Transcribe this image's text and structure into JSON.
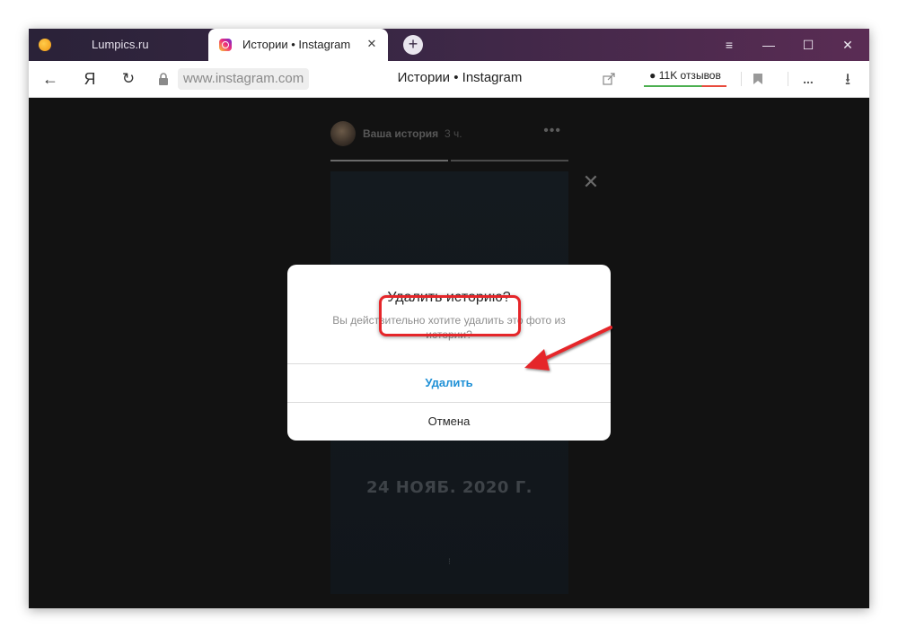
{
  "browser": {
    "tabs": [
      {
        "label": "Lumpics.ru",
        "active": false
      },
      {
        "label": "Истории • Instagram",
        "active": true
      }
    ],
    "new_tab_icon": "plus-icon",
    "window_controls": {
      "menu": "≡",
      "minimize": "—",
      "maximize": "☐",
      "close": "✕"
    },
    "tab_close": "✕",
    "address_bar": {
      "back": "←",
      "yandex": "Я",
      "reload": "↻",
      "url": "www.instagram.com",
      "page_title": "Истории • Instagram",
      "reviews_label": "11K отзывов",
      "more": "...",
      "download": "⭳"
    }
  },
  "story": {
    "user": "Ваша история",
    "time": "3 ч.",
    "more": "•••",
    "close": "✕",
    "date_text": "24 НОЯБ. 2020 Г.",
    "bottom_mark": "⁝",
    "progress": [
      1.0,
      0.0
    ]
  },
  "modal": {
    "title": "Удалить историю?",
    "description": "Вы действительно хотите удалить это фото из истории?",
    "delete_label": "Удалить",
    "cancel_label": "Отмена"
  },
  "colors": {
    "tab_bar": "#3a2745",
    "accent_link": "#1e90d6",
    "annotation": "#e5262a"
  }
}
